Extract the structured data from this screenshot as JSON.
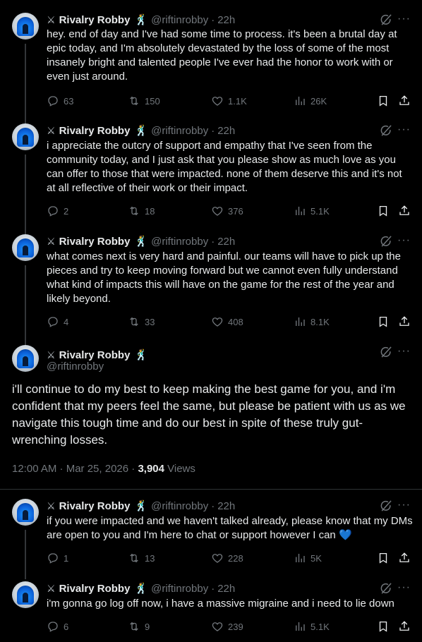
{
  "author": {
    "name": "Rivalry Robby",
    "handle": "@riftinrobby",
    "name_prefix_glyph": "⚔",
    "name_suffix_glyph": "🕺"
  },
  "tweets": [
    {
      "time": "22h",
      "text": "hey. end of day and I've had some time to process. it's been a brutal day at epic today, and I'm absolutely devastated by the loss of some of the most insanely bright and talented people I've ever had the honor to work with or even just around.",
      "replies": "63",
      "reposts": "150",
      "likes": "1.1K",
      "views": "26K"
    },
    {
      "time": "22h",
      "text": "i appreciate the outcry of support and empathy that I've seen from the community today, and I just ask that you please show as much love as you can offer to those that were impacted. none of them deserve this and it's not at all reflective of their work or their impact.",
      "replies": "2",
      "reposts": "18",
      "likes": "376",
      "views": "5.1K"
    },
    {
      "time": "22h",
      "text": "what comes next is very hard and painful. our teams will have to pick up the pieces and try to keep moving forward but we cannot even fully understand what kind of impacts this will have on the game for the rest of the year and likely beyond.",
      "replies": "4",
      "reposts": "33",
      "likes": "408",
      "views": "8.1K"
    }
  ],
  "main_tweet": {
    "text": "i'll continue to do my best to keep making the best game for you, and i'm confident that my peers feel the same, but please be patient with us as we navigate this tough time and do our best in spite of these truly gut-wrenching losses.",
    "timestamp": "12:00 AM · Mar 25, 2026 · ",
    "views_count": "3,904",
    "views_label": " Views"
  },
  "replies": [
    {
      "time": "22h",
      "text": "if you were impacted and we haven't talked already, please know that my DMs are open to you and I'm here to chat or support however I can ",
      "emoji": "💙",
      "replies": "1",
      "reposts": "13",
      "likes": "228",
      "views": "5K"
    },
    {
      "time": "22h",
      "text": "i'm gonna go log off now, i have a massive migraine and i need to lie down",
      "replies": "6",
      "reposts": "9",
      "likes": "239",
      "views": "5.1K"
    }
  ],
  "icons": [
    "reply-icon",
    "repost-icon",
    "like-icon",
    "views-icon",
    "bookmark-icon",
    "share-icon",
    "grok-icon",
    "more-icon"
  ],
  "colors": {
    "background": "#000000",
    "text": "#e7e9ea",
    "muted": "#71767b",
    "heart": "#1d9bf0",
    "divider": "#2f3336"
  }
}
